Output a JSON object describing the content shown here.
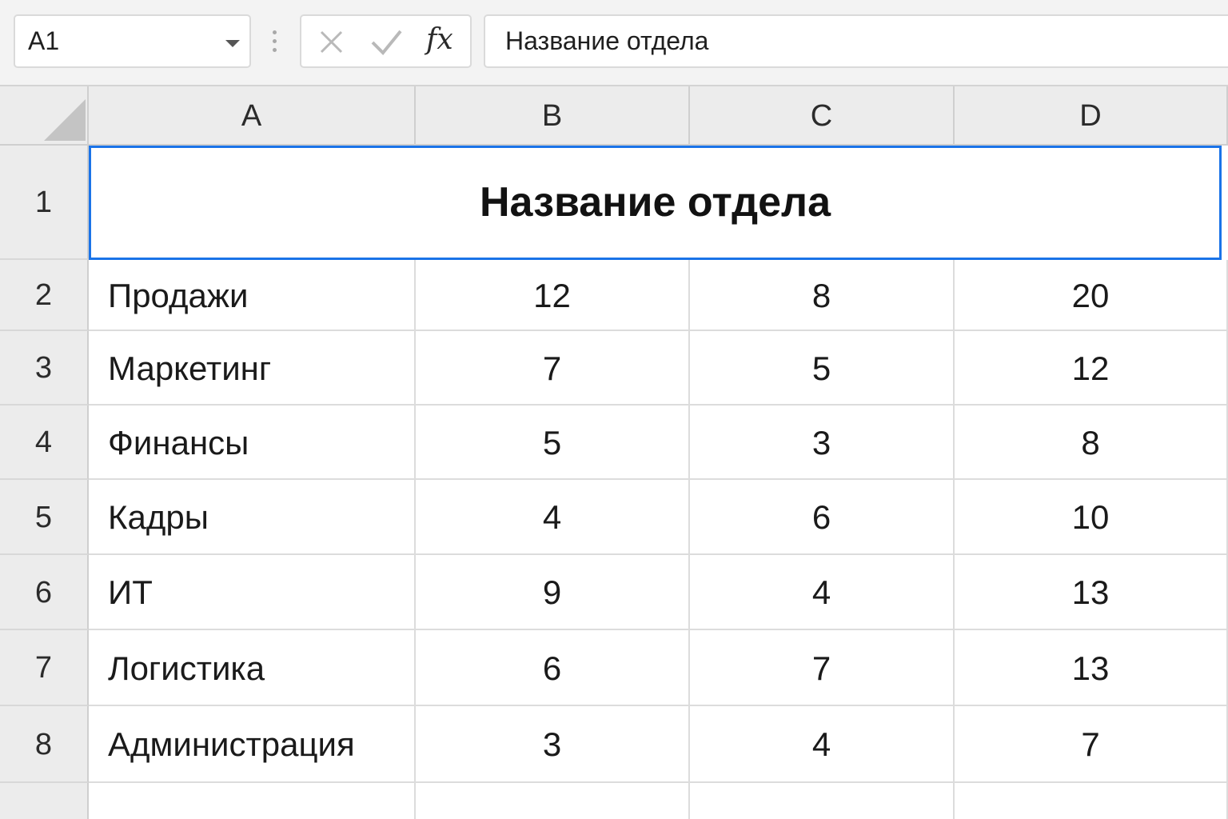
{
  "formula_bar": {
    "name_box": "A1",
    "fx_label": "fx",
    "formula_text": "Название отдела"
  },
  "columns": [
    "A",
    "B",
    "C",
    "D"
  ],
  "row_numbers": [
    "1",
    "2",
    "3",
    "4",
    "5",
    "6",
    "7",
    "8"
  ],
  "sheet": {
    "title": "Название отдела",
    "rows": [
      [
        "Продажи",
        "12",
        "8",
        "20"
      ],
      [
        "Маркетинг",
        "7",
        "5",
        "12"
      ],
      [
        "Финансы",
        "5",
        "3",
        "8"
      ],
      [
        "Кадры",
        "4",
        "6",
        "10"
      ],
      [
        "ИТ",
        "9",
        "4",
        "13"
      ],
      [
        "Логистика",
        "6",
        "7",
        "13"
      ],
      [
        "Администрация",
        "3",
        "4",
        "7"
      ]
    ]
  },
  "colors": {
    "selection": "#1a73e8",
    "header_bg": "#ececec",
    "grid_line": "#dcdcdc"
  },
  "icons": {
    "cancel": "close-icon",
    "enter": "check-icon",
    "insert_function": "fx-icon",
    "name_box_dropdown": "chevron-down-icon",
    "select_all": "select-all-corner-icon"
  }
}
